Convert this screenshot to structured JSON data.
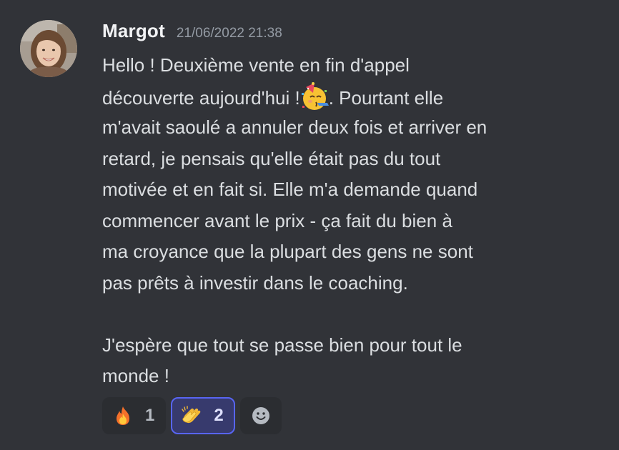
{
  "message": {
    "author": "Margot",
    "timestamp": "21/06/2022 21:38",
    "lines": [
      "Hello ! Deuxième vente en fin d'appel",
      "découverte aujourd'hui !",
      ". Pourtant elle",
      "m'avait saoulé a annuler deux fois et arriver en",
      "retard, je pensais qu'elle était pas du tout",
      "motivée et en fait si. Elle m'a demande quand",
      "commencer avant le prix - ça fait du bien à",
      "ma croyance que la plupart des gens ne sont",
      "pas prêts à investir dans le coaching.",
      "J'espère que tout se passe bien pour tout le",
      "monde !"
    ],
    "inline_emoji": "partying-face-icon"
  },
  "reactions": [
    {
      "emoji": "fire-icon",
      "count": "1",
      "selected": false
    },
    {
      "emoji": "clapping-hands-icon",
      "count": "2",
      "selected": true
    }
  ],
  "add_reaction_icon": "smiley-add-icon",
  "colors": {
    "background": "#313338",
    "username": "#f2f3f5",
    "timestamp": "#949ba4",
    "text": "#dbdee1",
    "reaction_bg": "#2b2d31",
    "reaction_selected_bg": "#373a6d",
    "reaction_selected_border": "#5865f2"
  }
}
